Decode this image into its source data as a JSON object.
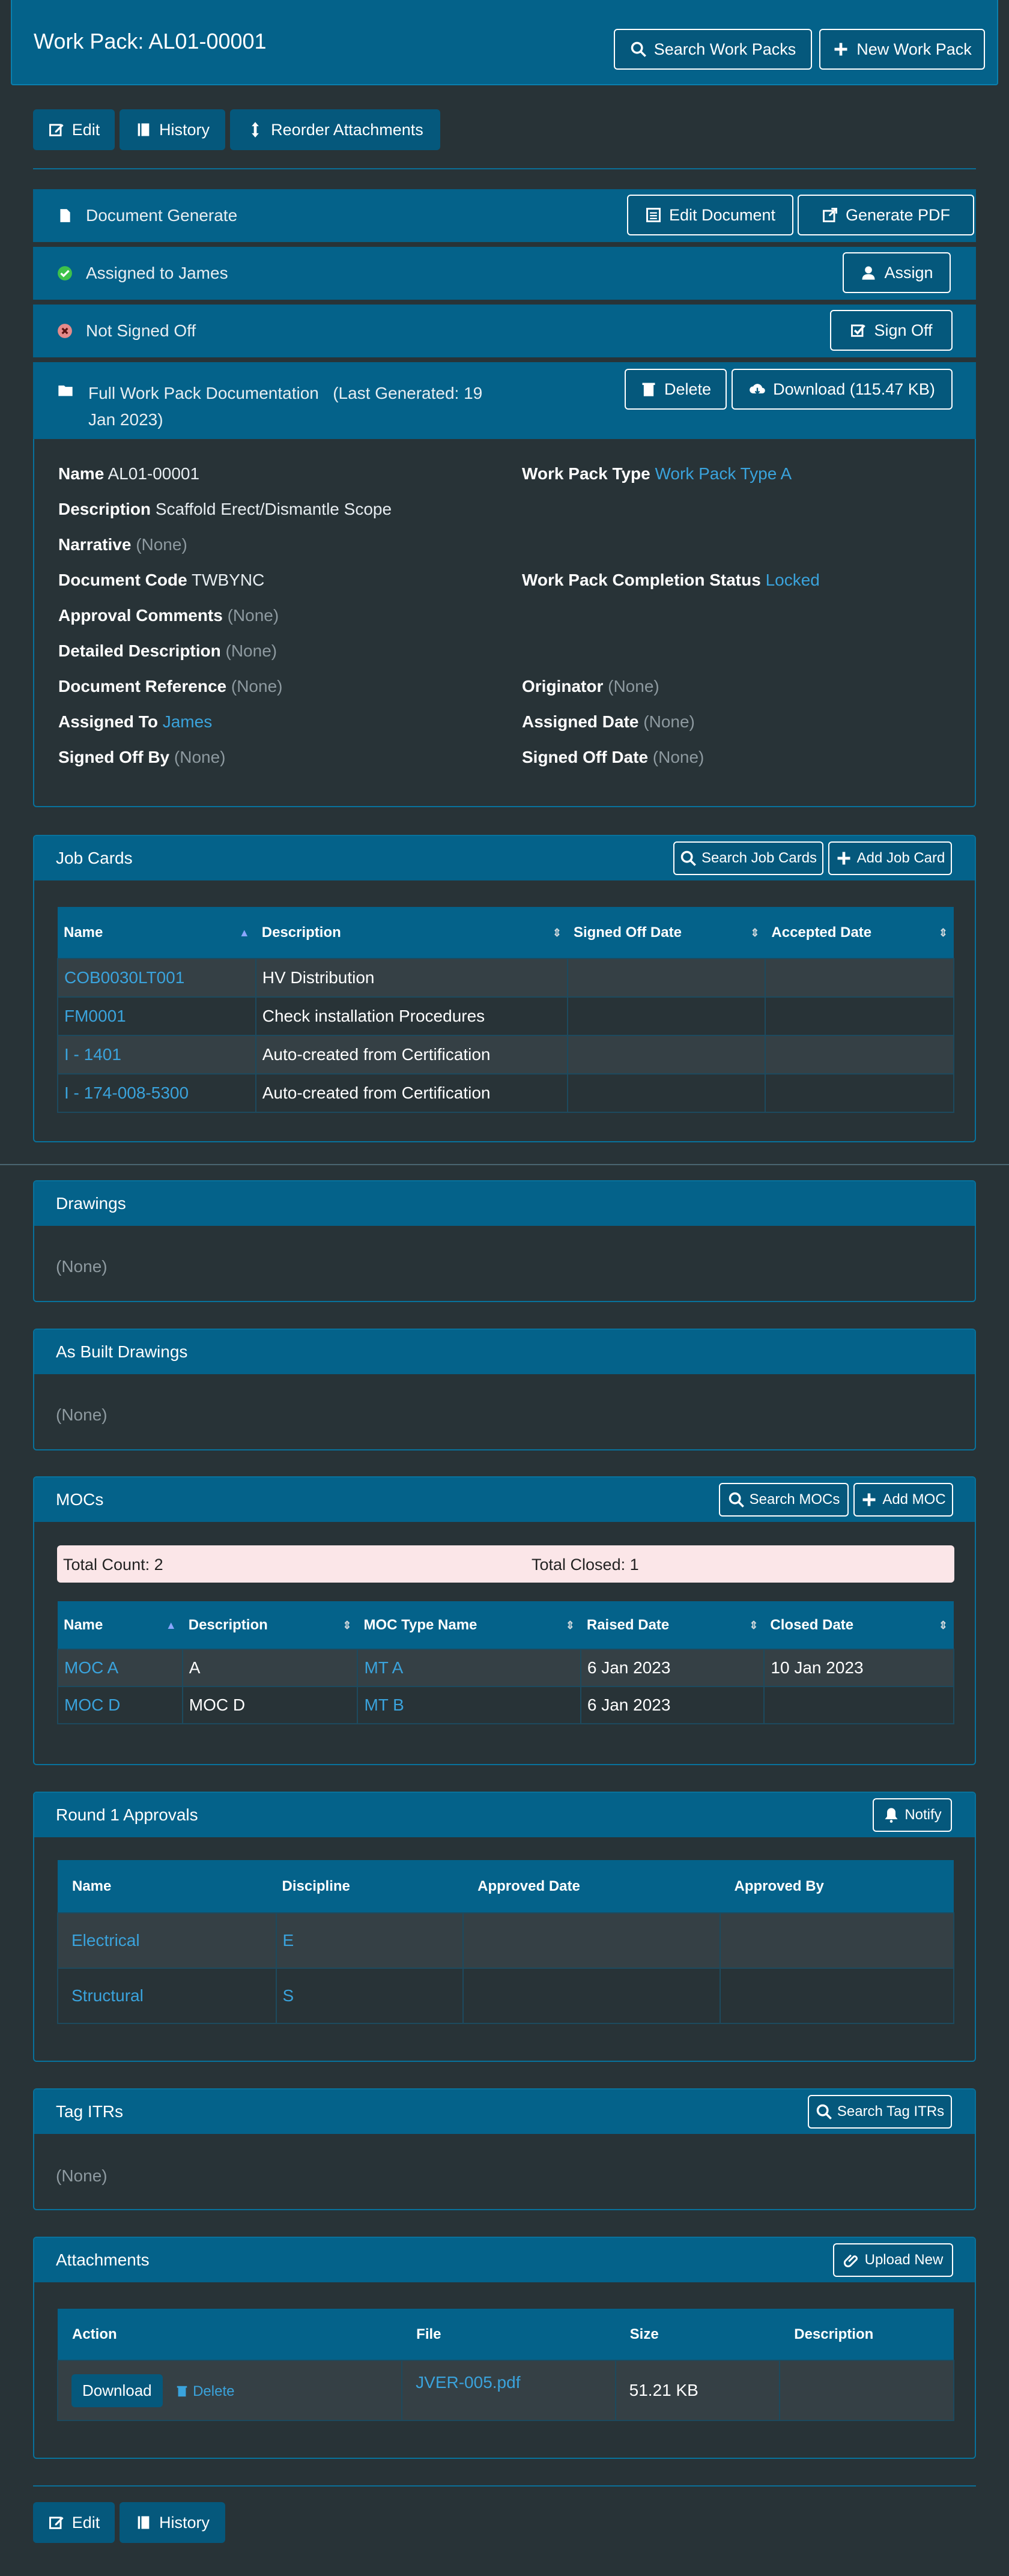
{
  "header": {
    "title": "Work Pack: AL01-00001",
    "search_label": "Search Work Packs",
    "new_label": "New Work Pack"
  },
  "toolbar": {
    "edit": "Edit",
    "history": "History",
    "reorder": "Reorder Attachments"
  },
  "actions": {
    "doc_generate": "Document Generate",
    "edit_document": "Edit Document",
    "generate_pdf": "Generate PDF",
    "assigned": "Assigned to James",
    "assign": "Assign",
    "not_signed": "Not Signed Off",
    "sign_off": "Sign Off",
    "full_doc_line1": "Full Work Pack Documentation   (Last Generated: 19",
    "full_doc_line2": "Jan 2023)",
    "delete": "Delete",
    "download": "Download (115.47 KB)"
  },
  "details": {
    "name_l": "Name",
    "name_v": "AL01-00001",
    "type_l": "Work Pack Type",
    "type_v": "Work Pack Type A",
    "desc_l": "Description",
    "desc_v": "Scaffold Erect/Dismantle Scope",
    "narr_l": "Narrative",
    "narr_v": "(None)",
    "code_l": "Document Code",
    "code_v": "TWBYNC",
    "comp_l": "Work Pack Completion Status",
    "comp_v": "Locked",
    "appr_l": "Approval Comments",
    "appr_v": "(None)",
    "det_l": "Detailed Description",
    "det_v": "(None)",
    "ref_l": "Document Reference",
    "ref_v": "(None)",
    "orig_l": "Originator",
    "orig_v": "(None)",
    "asg_l": "Assigned To",
    "asg_v": "James",
    "asgd_l": "Assigned Date",
    "asgd_v": "(None)",
    "sob_l": "Signed Off By",
    "sob_v": "(None)",
    "sod_l": "Signed Off Date",
    "sod_v": "(None)"
  },
  "jobcards": {
    "title": "Job Cards",
    "search": "Search Job Cards",
    "add": "Add Job Card",
    "cols": [
      "Name",
      "Description",
      "Signed Off Date",
      "Accepted Date"
    ],
    "rows": [
      [
        "COB0030LT001",
        "HV Distribution",
        "",
        ""
      ],
      [
        "FM0001",
        "Check installation Procedures",
        "",
        ""
      ],
      [
        "I - 1401",
        "Auto-created from Certification",
        "",
        ""
      ],
      [
        "I - 174-008-5300",
        "Auto-created from Certification",
        "",
        ""
      ]
    ]
  },
  "drawings": {
    "title": "Drawings",
    "none": "(None)"
  },
  "asbuilt": {
    "title": "As Built Drawings",
    "none": "(None)"
  },
  "mocs": {
    "title": "MOCs",
    "search": "Search MOCs",
    "add": "Add MOC",
    "total": "Total Count: 2",
    "closed": "Total Closed: 1",
    "cols": [
      "Name",
      "Description",
      "MOC Type Name",
      "Raised Date",
      "Closed Date"
    ],
    "rows": [
      [
        "MOC A",
        "A",
        "MT A",
        "6 Jan 2023",
        "10 Jan 2023"
      ],
      [
        "MOC D",
        "MOC D",
        "MT B",
        "6 Jan 2023",
        ""
      ]
    ]
  },
  "approvals": {
    "title": "Round 1 Approvals",
    "notify": "Notify",
    "cols": [
      "Name",
      "Discipline",
      "Approved Date",
      "Approved By"
    ],
    "rows": [
      [
        "Electrical",
        "E",
        "",
        ""
      ],
      [
        "Structural",
        "S",
        "",
        ""
      ]
    ]
  },
  "tagitrs": {
    "title": "Tag ITRs",
    "search": "Search Tag ITRs",
    "none": "(None)"
  },
  "attachments": {
    "title": "Attachments",
    "upload": "Upload New",
    "cols": [
      "Action",
      "File",
      "Size",
      "Description"
    ],
    "download": "Download",
    "delete": "Delete",
    "file": "JVER-005.pdf",
    "size": "51.21 KB",
    "desc": ""
  },
  "footer": {
    "edit": "Edit",
    "history": "History"
  },
  "colors": {
    "header_blue": "#04628a",
    "link": "#3aa3dc",
    "bg": "#283337",
    "total_bar": "#fbe6e8"
  }
}
